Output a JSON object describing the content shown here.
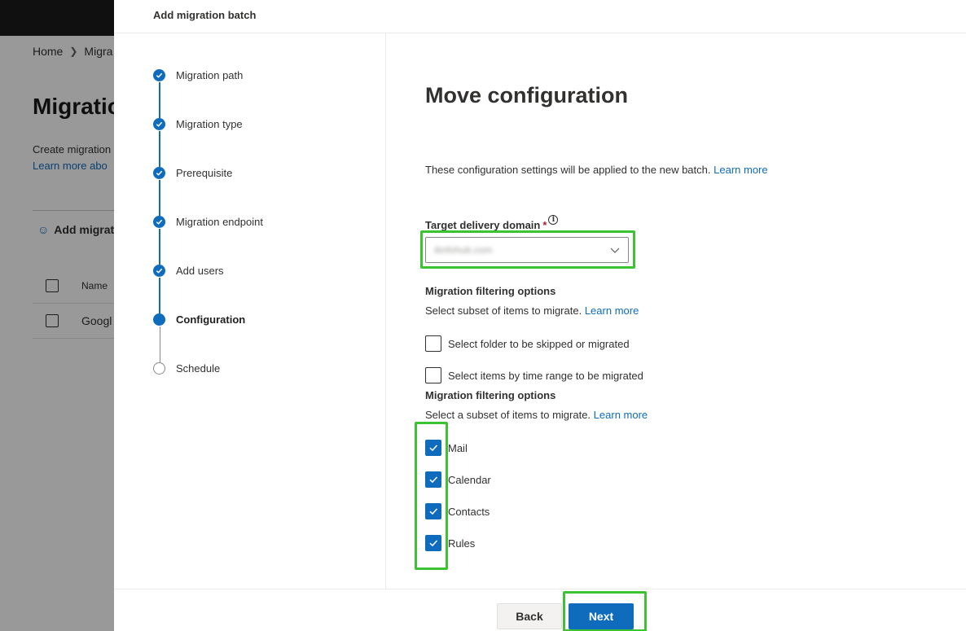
{
  "background": {
    "breadcrumb": [
      "Home",
      "Migra"
    ],
    "title": "Migratio",
    "description_line1": "Create migration",
    "description_link": "Learn more abo",
    "command_label": "Add migrat",
    "table_header_name": "Name",
    "table_row_name": "Googl"
  },
  "panel": {
    "title": "Add migration batch",
    "steps": [
      {
        "label": "Migration path",
        "state": "done"
      },
      {
        "label": "Migration type",
        "state": "done"
      },
      {
        "label": "Prerequisite",
        "state": "done"
      },
      {
        "label": "Migration endpoint",
        "state": "done"
      },
      {
        "label": "Add users",
        "state": "done"
      },
      {
        "label": "Configuration",
        "state": "current"
      },
      {
        "label": "Schedule",
        "state": "todo"
      }
    ]
  },
  "content": {
    "heading": "Move configuration",
    "intro_text": "These configuration settings will be applied to the new batch.",
    "intro_link": "Learn more",
    "target_domain": {
      "label": "Target delivery domain",
      "required_mark": "*",
      "info_icon": "i",
      "value": "itinfohub.com"
    },
    "filter_section_1": {
      "title": "Migration filtering options",
      "desc": "Select subset of items to migrate.",
      "link": "Learn more",
      "options": [
        {
          "label": "Select folder to be skipped or migrated",
          "checked": false
        },
        {
          "label": "Select items by time range to be migrated",
          "checked": false
        }
      ]
    },
    "filter_section_2": {
      "title": "Migration filtering options",
      "desc": "Select a subset of items to migrate.",
      "link": "Learn more",
      "options": [
        {
          "label": "Mail",
          "checked": true
        },
        {
          "label": "Calendar",
          "checked": true
        },
        {
          "label": "Contacts",
          "checked": true
        },
        {
          "label": "Rules",
          "checked": true
        }
      ]
    }
  },
  "footer": {
    "back_label": "Back",
    "next_label": "Next"
  },
  "colors": {
    "accent": "#0f6cbd",
    "highlight": "#3cc332",
    "required": "#a4262c"
  }
}
